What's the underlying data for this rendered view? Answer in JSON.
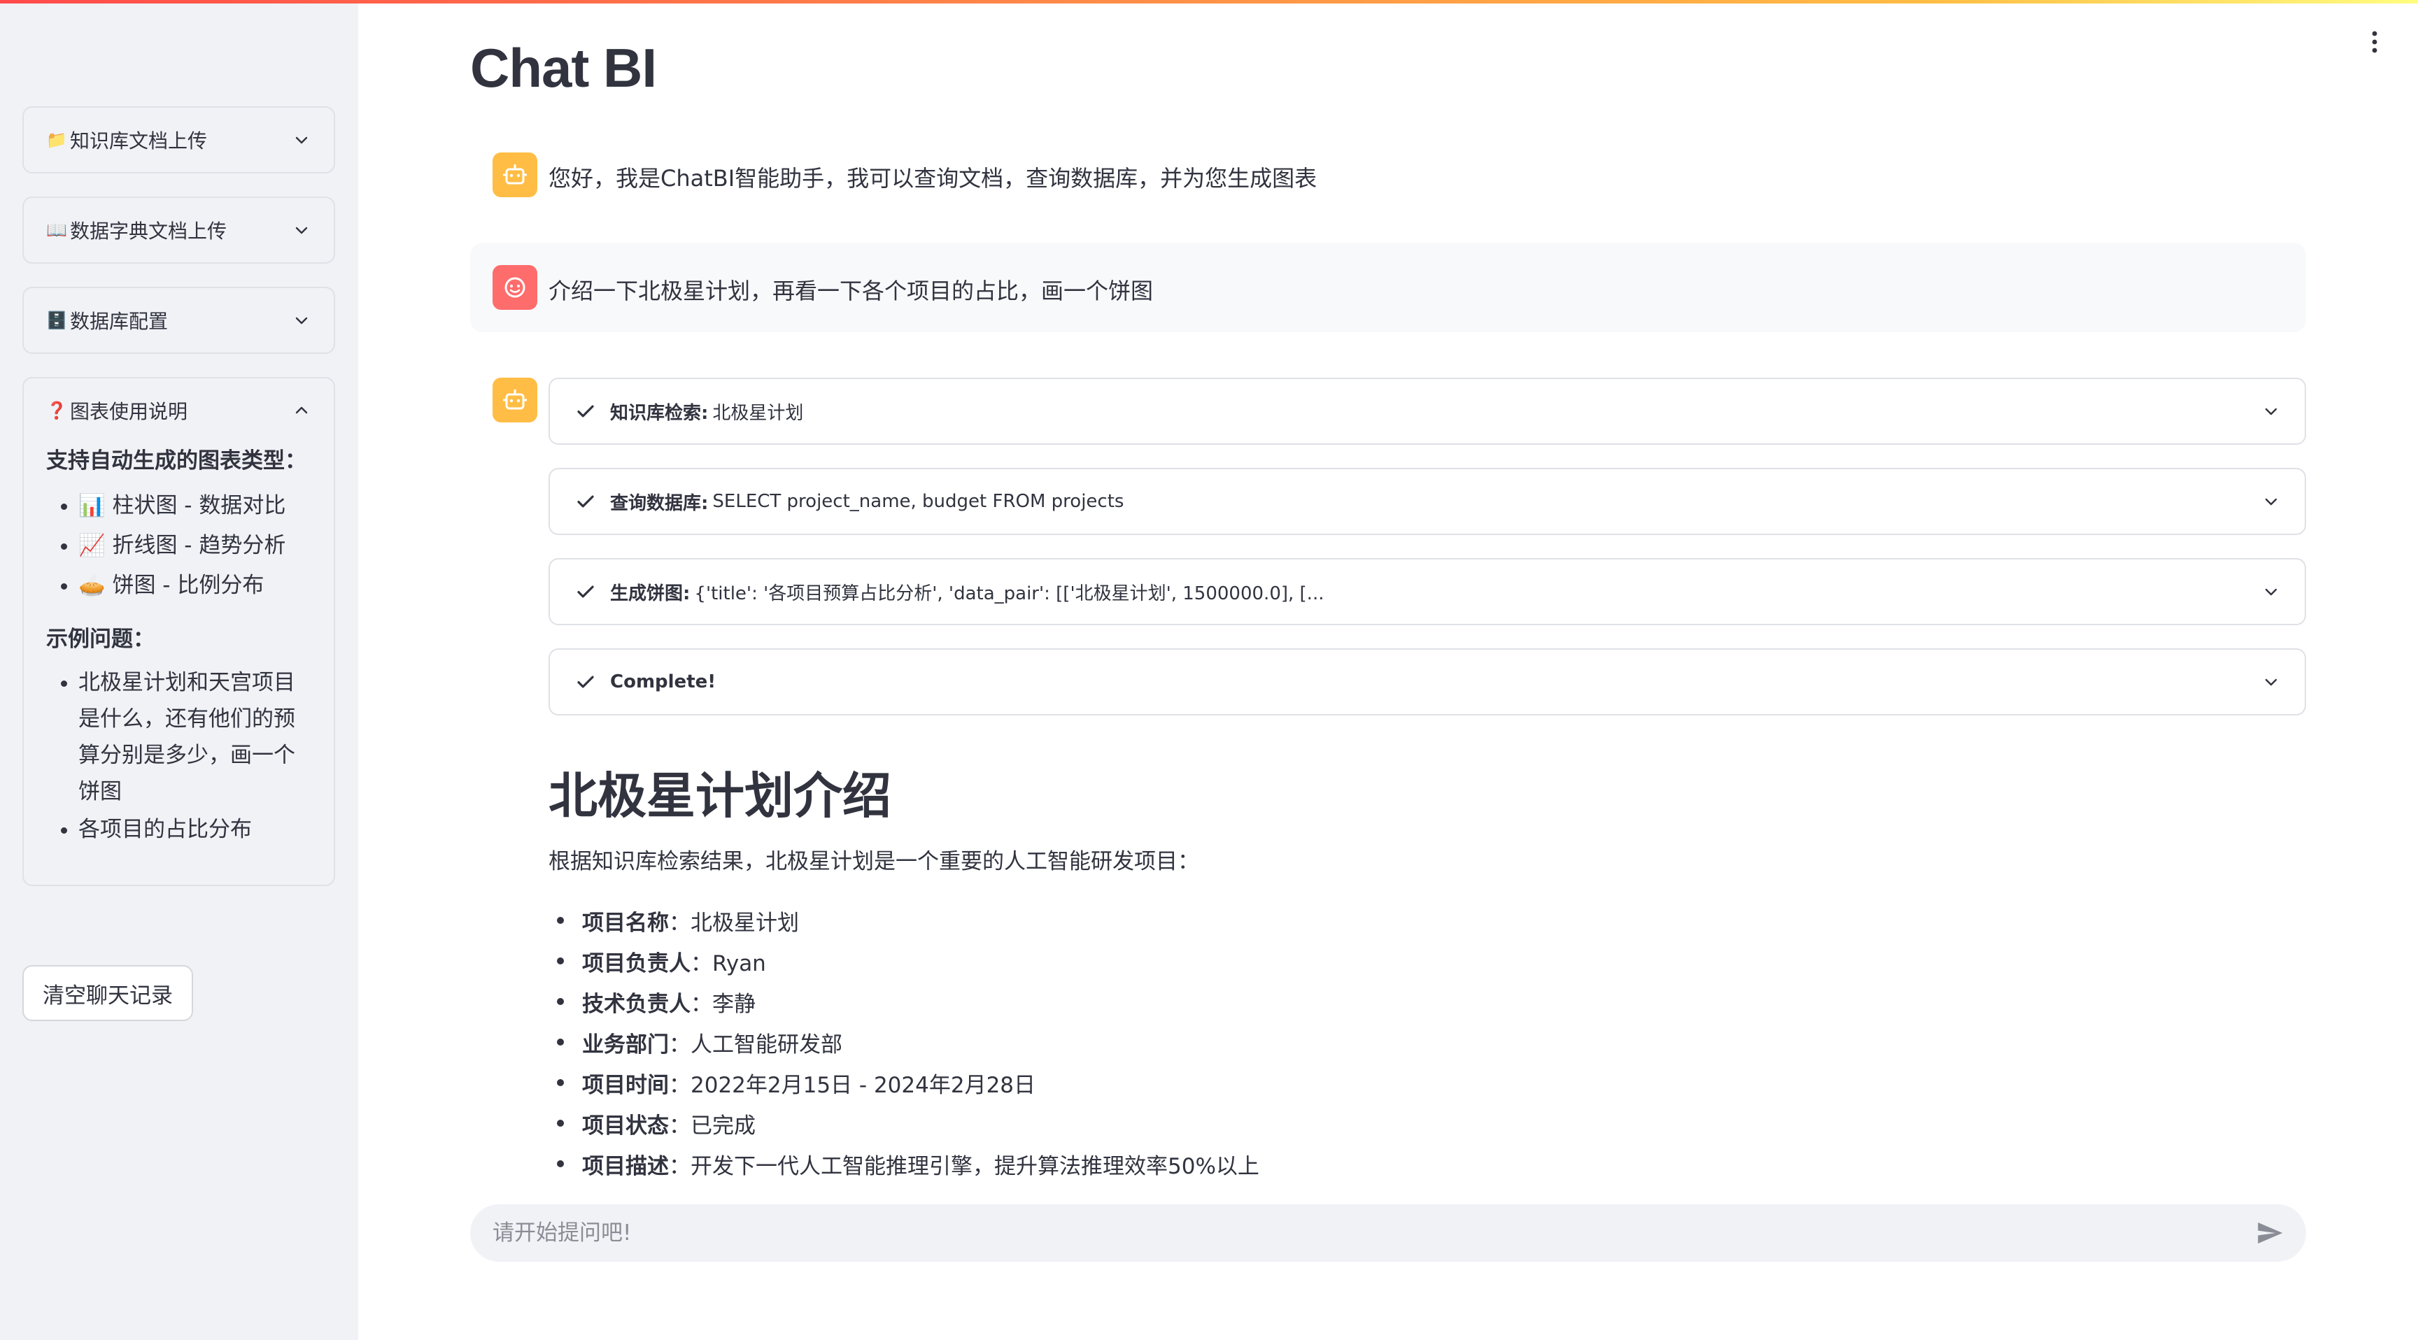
{
  "app": {
    "title": "Chat BI"
  },
  "sidebar": {
    "expanders": [
      {
        "icon": "📁",
        "label": "知识库文档上传"
      },
      {
        "icon": "📖",
        "label": "数据字典文档上传"
      },
      {
        "icon": "🗄️",
        "label": "数据库配置"
      },
      {
        "icon": "❓",
        "label": "图表使用说明"
      }
    ],
    "chart_help": {
      "heading": "支持自动生成的图表类型：",
      "types": [
        "📊 柱状图 - 数据对比",
        "📈 折线图 - 趋势分析",
        "🥧 饼图 - 比例分布"
      ],
      "examples_heading": "示例问题：",
      "examples": [
        "北极星计划和天宫项目是什么，还有他们的预算分别是多少，画一个饼图",
        "各项目的占比分布"
      ]
    },
    "clear_button": "清空聊天记录"
  },
  "chat": {
    "greeting": "您好，我是ChatBI智能助手，我可以查询文档，查询数据库，并为您生成图表",
    "user_message": "介绍一下北极星计划，再看一下各个项目的占比，画一个饼图",
    "steps": [
      {
        "label": "知识库检索:",
        "value": "北极星计划"
      },
      {
        "label": "查询数据库:",
        "value": "SELECT project_name, budget FROM projects"
      },
      {
        "label": "生成饼图:",
        "value": "{'title': '各项目预算占比分析', 'data_pair': [['北极星计划', 1500000.0], [..."
      },
      {
        "label": "Complete!",
        "value": ""
      }
    ],
    "answer": {
      "heading": "北极星计划介绍",
      "intro": "根据知识库检索结果，北极星计划是一个重要的人工智能研发项目：",
      "items": [
        {
          "key": "项目名称",
          "value": "：北极星计划"
        },
        {
          "key": "项目负责人",
          "value": "：Ryan"
        },
        {
          "key": "技术负责人",
          "value": "：李静"
        },
        {
          "key": "业务部门",
          "value": "：人工智能研发部"
        },
        {
          "key": "项目时间",
          "value": "：2022年2月15日 - 2024年2月28日"
        },
        {
          "key": "项目状态",
          "value": "：已完成"
        },
        {
          "key": "项目描述",
          "value": "：开发下一代人工智能推理引擎，提升算法推理效率50%以上"
        }
      ]
    },
    "input": {
      "placeholder": "请开始提问吧!",
      "value": ""
    }
  }
}
